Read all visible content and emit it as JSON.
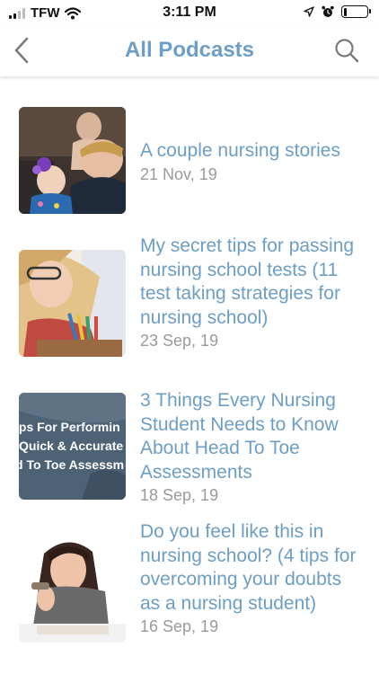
{
  "status_bar": {
    "carrier": "TFW",
    "time": "3:11 PM",
    "icons": [
      "signal-icon",
      "wifi-icon",
      "location-icon",
      "alarm-icon",
      "battery-icon"
    ],
    "battery_level": 0.15
  },
  "nav": {
    "title": "All Podcasts",
    "back_icon": "chevron-left-icon",
    "search_icon": "search-icon",
    "accent_color": "#6c9ec6"
  },
  "podcasts": [
    {
      "title": "A couple nursing stories",
      "date": "21 Nov, 19"
    },
    {
      "title": "My secret tips for passing nursing school tests (11 test taking strategies for nursing school)",
      "date": "23 Sep, 19"
    },
    {
      "title": "3 Things Every Nursing Student Needs to Know About Head To Toe Assessments",
      "date": "18 Sep, 19",
      "thumb_text": [
        "ips For Performin",
        "Quick & Accurate",
        "d To Toe Assessm"
      ]
    },
    {
      "title": "Do you feel like this in nursing school? (4 tips for overcoming your doubts as a nursing student)",
      "date": "16 Sep, 19"
    }
  ]
}
